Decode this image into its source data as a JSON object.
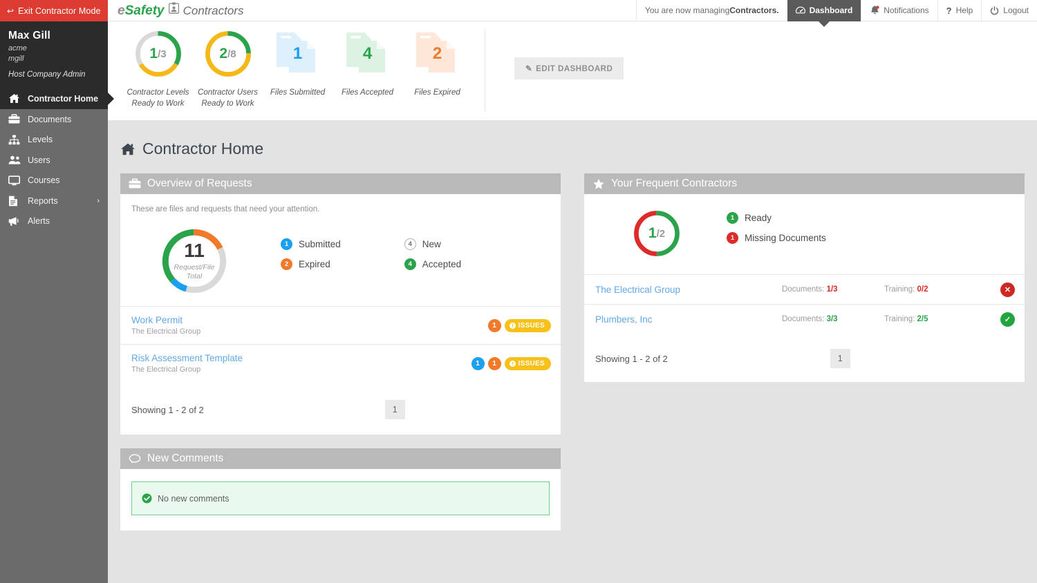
{
  "sidebar": {
    "exit_label": "Exit Contractor Mode",
    "user": {
      "name": "Max Gill",
      "company": "acme",
      "username": "mgill",
      "role": "Host Company Admin"
    },
    "items": [
      {
        "label": "Contractor Home",
        "icon": "home-icon",
        "active": true
      },
      {
        "label": "Documents",
        "icon": "briefcase-icon",
        "active": false
      },
      {
        "label": "Levels",
        "icon": "sitemap-icon",
        "active": false
      },
      {
        "label": "Users",
        "icon": "users-icon",
        "active": false
      },
      {
        "label": "Courses",
        "icon": "monitor-icon",
        "active": false
      },
      {
        "label": "Reports",
        "icon": "file-icon",
        "active": false,
        "chevron": "›"
      },
      {
        "label": "Alerts",
        "icon": "megaphone-icon",
        "active": false
      }
    ]
  },
  "topbar": {
    "brand_e": "e",
    "brand_safety": "Safety",
    "brand_section": "Contractors",
    "managing_prefix": "You are now managing ",
    "managing_target": "Contractors.",
    "nav": [
      {
        "label": "Dashboard",
        "icon": "dashboard-icon",
        "active": true
      },
      {
        "label": "Notifications",
        "icon": "bell-icon",
        "active": false
      },
      {
        "label": "Help",
        "icon": "question-icon",
        "active": false
      },
      {
        "label": "Logout",
        "icon": "power-icon",
        "active": false
      }
    ]
  },
  "kpi": {
    "edit_label": "EDIT DASHBOARD",
    "items": [
      {
        "type": "donut",
        "num": "1",
        "den": "/3",
        "label": "Contractor Levels\nReady to Work",
        "segments": [
          {
            "color": "#2aa34a",
            "value": 1
          },
          {
            "color": "#f5b819",
            "value": 1
          },
          {
            "color": "#d9d9d9",
            "value": 1
          }
        ]
      },
      {
        "type": "donut",
        "num": "2",
        "den": "/8",
        "label": "Contractor Users\nReady to Work",
        "segments": [
          {
            "color": "#2aa34a",
            "value": 2
          },
          {
            "color": "#f5b819",
            "value": 6
          }
        ]
      },
      {
        "type": "file",
        "num": "1",
        "label": "Files Submitted",
        "color": "#1b9ff0",
        "tint": "#ddeffb"
      },
      {
        "type": "file",
        "num": "4",
        "label": "Files Accepted",
        "color": "#2aa34a",
        "tint": "#ddf2e2"
      },
      {
        "type": "file",
        "num": "2",
        "label": "Files Expired",
        "color": "#f07a2a",
        "tint": "#fce7d8"
      }
    ]
  },
  "page": {
    "title": "Contractor Home",
    "icon": "home-icon"
  },
  "overview": {
    "heading": "Overview of Requests",
    "heading_icon": "briefcase-icon",
    "note": "These are files and requests that need your attention.",
    "chart_data": {
      "type": "pie",
      "title": "Request/File Total",
      "total": 11,
      "categories": [
        "Expired",
        "New",
        "Submitted",
        "Accepted"
      ],
      "values": [
        2,
        4,
        1,
        4
      ],
      "colors": [
        "#f07a2a",
        "#d9d9d9",
        "#1b9ff0",
        "#2aa34a"
      ],
      "legend": "right"
    },
    "center_number": "11",
    "center_caption": "Request/File\nTotal",
    "legend": [
      {
        "count": "1",
        "label": "Submitted",
        "color": "#1b9ff0",
        "hollow": false
      },
      {
        "count": "2",
        "label": "Expired",
        "color": "#f07a2a",
        "hollow": false
      },
      {
        "count": "4",
        "label": "New",
        "color": "#ffffff",
        "hollow": true
      },
      {
        "count": "4",
        "label": "Accepted",
        "color": "#2aa34a",
        "hollow": false
      }
    ],
    "rows": [
      {
        "title": "Work Permit",
        "sub": "The Electrical Group",
        "badges": [
          {
            "count": "1",
            "color": "#f07a2a"
          }
        ],
        "pill": "ISSUES"
      },
      {
        "title": "Risk Assessment Template",
        "sub": "The Electrical Group",
        "badges": [
          {
            "count": "1",
            "color": "#1b9ff0"
          },
          {
            "count": "1",
            "color": "#f07a2a"
          }
        ],
        "pill": "ISSUES"
      }
    ],
    "showing": "Showing 1 - 2 of 2",
    "page_number": "1"
  },
  "comments": {
    "heading": "New Comments",
    "heading_icon": "comment-icon",
    "empty_text": "No new comments"
  },
  "frequent": {
    "heading": "Your Frequent Contractors",
    "heading_icon": "star-icon",
    "chart_data": {
      "type": "pie",
      "title": "Frequent Contractors Readiness",
      "total": 2,
      "categories": [
        "Ready",
        "Missing Documents"
      ],
      "values": [
        1,
        1
      ],
      "colors": [
        "#2aa34a",
        "#dc2b28"
      ],
      "legend": "right"
    },
    "num": "1",
    "den": "/2",
    "legend": [
      {
        "count": "1",
        "label": "Ready",
        "color": "#2aa34a"
      },
      {
        "count": "1",
        "label": "Missing Documents",
        "color": "#dc2b28"
      }
    ],
    "rows": [
      {
        "name": "The Electrical Group",
        "documents_label": "Documents: ",
        "documents_value": "1/3",
        "documents_color": "#dc2b28",
        "training_label": "Training: ",
        "training_value": "0/2",
        "training_color": "#dc2b28",
        "status": "✕",
        "status_color": "#cf2723"
      },
      {
        "name": "Plumbers, Inc",
        "documents_label": "Documents: ",
        "documents_value": "3/3",
        "documents_color": "#2aa34a",
        "training_label": "Training: ",
        "training_value": "2/5",
        "training_color": "#2aa34a",
        "status": "✓",
        "status_color": "#22a53f"
      }
    ],
    "showing": "Showing 1 - 2 of 2",
    "page_number": "1"
  }
}
